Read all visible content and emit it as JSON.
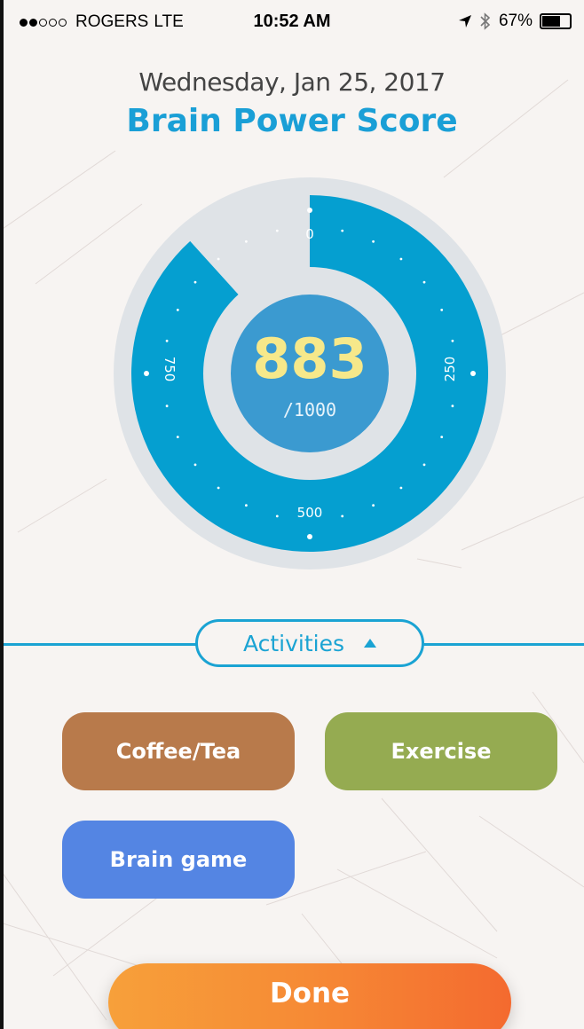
{
  "status_bar": {
    "carrier": "ROGERS",
    "network": "LTE",
    "time": "10:52 AM",
    "battery": "67%",
    "battery_level": 0.67,
    "signal_strength": 2,
    "signal_total": 5,
    "icons": [
      "location-arrow-icon",
      "bluetooth-icon",
      "battery-icon"
    ]
  },
  "header": {
    "date": "Wednesday, Jan 25, 2017",
    "title": "Brain Power Score"
  },
  "score": {
    "value": "883",
    "max_label": "/1000",
    "numeric_value": 883,
    "numeric_max": 1000,
    "tick_labels": [
      "0",
      "250",
      "500",
      "750"
    ]
  },
  "activities": {
    "label": "Activities",
    "buttons": [
      {
        "label": "Coffee/Tea",
        "color": "#b87a4b"
      },
      {
        "label": "Exercise",
        "color": "#95ab51"
      },
      {
        "label": "Brain game",
        "color": "#5485e3"
      }
    ]
  },
  "done_label": "Done",
  "colors": {
    "accent": "#1aa3d3",
    "gauge_fill": "#059fd0",
    "gauge_track": "#dfe3e7",
    "score_text": "#f6e88a",
    "done_start": "#f7a03a",
    "done_end": "#f46a2f"
  }
}
